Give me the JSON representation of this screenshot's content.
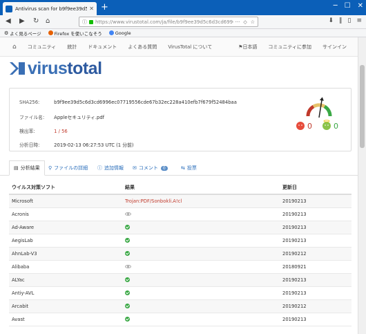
{
  "browser": {
    "tab_title": "Antivirus scan for b9f9ee39d5c...",
    "url": "https://www.virustotal.com/ja/file/b9f9ee39d5c6d3cd6996ec0771...",
    "bookmarks": [
      "よく見るページ",
      "Firefox を使いこなそう",
      "Google"
    ]
  },
  "sitenav": {
    "items": [
      "コミュニティ",
      "統計",
      "ドキュメント",
      "よくある質問",
      "VirusTotal について"
    ],
    "right": [
      "日本語",
      "コミュニティに参加",
      "サインイン"
    ]
  },
  "logo": {
    "text_light": "virus",
    "text_bold": "total"
  },
  "summary": {
    "sha256_label": "SHA256:",
    "sha256_value": "b9f9ee39d5c6d3cd6996ec07719556cde67b32ec228a410efb7f679f52484baa",
    "filename_label": "ファイル名:",
    "filename_value": "Appleセキュリティ.pdf",
    "ratio_label": "検出率:",
    "ratio_value": "1 / 56",
    "date_label": "分析日時:",
    "date_value": "2019-02-13 06:27:53 UTC (1 分前)",
    "bad_votes": "0",
    "good_votes": "0",
    "gauge_level": 0.05
  },
  "tabs": [
    {
      "label": "分析結果",
      "icon": "table-icon"
    },
    {
      "label": "ファイルの詳細",
      "icon": "search-icon"
    },
    {
      "label": "追加情報",
      "icon": "info-icon"
    },
    {
      "label": "コメント",
      "icon": "comment-icon",
      "badge": "0"
    },
    {
      "label": "投票",
      "icon": "vote-icon"
    }
  ],
  "table": {
    "headers": [
      "ウイルス対策ソフト",
      "結果",
      "更新日"
    ],
    "rows": [
      {
        "engine": "Microsoft",
        "result": "Trojan:PDF/Sonbokli.A!cl",
        "status": "detected",
        "date": "20190213"
      },
      {
        "engine": "Acronis",
        "result": "",
        "status": "unsupported",
        "date": "20190213"
      },
      {
        "engine": "Ad-Aware",
        "result": "",
        "status": "clean",
        "date": "20190213"
      },
      {
        "engine": "AegisLab",
        "result": "",
        "status": "clean",
        "date": "20190213"
      },
      {
        "engine": "AhnLab-V3",
        "result": "",
        "status": "clean",
        "date": "20190212"
      },
      {
        "engine": "Alibaba",
        "result": "",
        "status": "unsupported",
        "date": "20180921"
      },
      {
        "engine": "ALYac",
        "result": "",
        "status": "clean",
        "date": "20190213"
      },
      {
        "engine": "Antiy-AVL",
        "result": "",
        "status": "clean",
        "date": "20190213"
      },
      {
        "engine": "Arcabit",
        "result": "",
        "status": "clean",
        "date": "20190212"
      },
      {
        "engine": "Avast",
        "result": "",
        "status": "clean",
        "date": "20190213"
      }
    ]
  }
}
